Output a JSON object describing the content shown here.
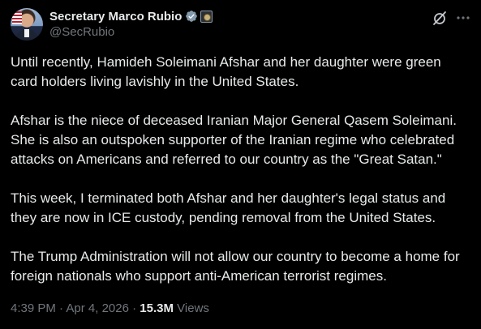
{
  "author": {
    "display_name": "Secretary Marco Rubio",
    "handle": "@SecRubio"
  },
  "post": {
    "paragraphs": [
      "Until recently, Hamideh Soleimani Afshar and her daughter were green card holders living lavishly in the United States.",
      "Afshar is the niece of deceased Iranian Major General Qasem Soleimani. She is also an outspoken supporter of the Iranian regime who celebrated attacks on Americans and referred to our country as the \"Great Satan.\"",
      "This week, I terminated both Afshar and her daughter's legal status and they are now in ICE custody, pending removal from the United States.",
      "The Trump Administration will not allow our country to become a home for foreign nationals who support anti-American terrorist regimes."
    ]
  },
  "meta": {
    "time": "4:39 PM",
    "separator": " · ",
    "date": "Apr 4, 2026",
    "views_count": "15.3M",
    "views_label": "Views"
  },
  "icons": {
    "verified": "verified-badge-icon",
    "government_seal": "government-seal-icon",
    "grok": "grok-icon",
    "more": "more-options-icon"
  },
  "colors": {
    "background": "#000000",
    "primary_text": "#e7e9ea",
    "secondary_text": "#71767b",
    "verified_badge": "#829aab"
  }
}
